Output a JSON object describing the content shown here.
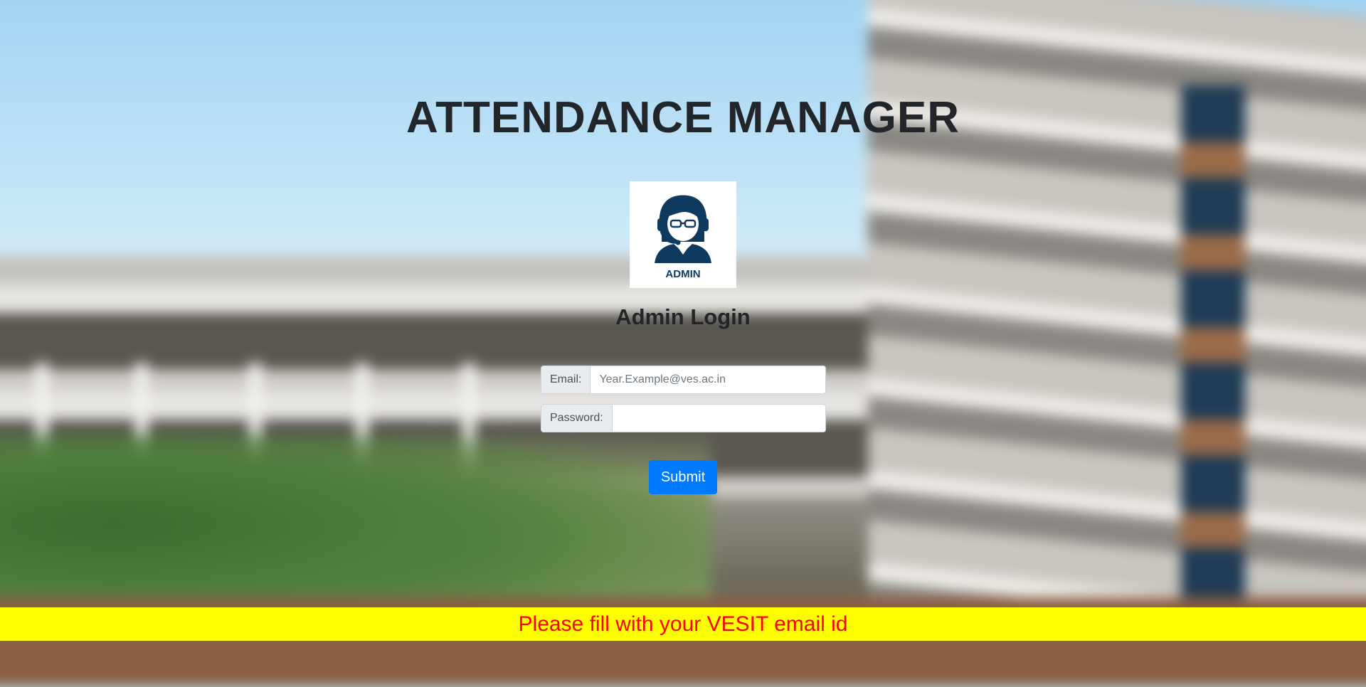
{
  "page": {
    "title": "ATTENDANCE MANAGER",
    "avatar": {
      "icon": "admin-avatar-icon",
      "caption": "ADMIN",
      "color": "#0f3a5f"
    },
    "subtitle": "Admin Login"
  },
  "form": {
    "email": {
      "label": "Email:",
      "placeholder": "Year.Example@ves.ac.in",
      "value": ""
    },
    "password": {
      "label": "Password:",
      "placeholder": "",
      "value": ""
    },
    "submit_label": "Submit"
  },
  "notice": {
    "text": "Please fill with your VESIT email id",
    "bg_color": "#ffff00",
    "text_color": "#ff0000"
  },
  "colors": {
    "primary": "#007bff",
    "heading": "#22252a"
  }
}
